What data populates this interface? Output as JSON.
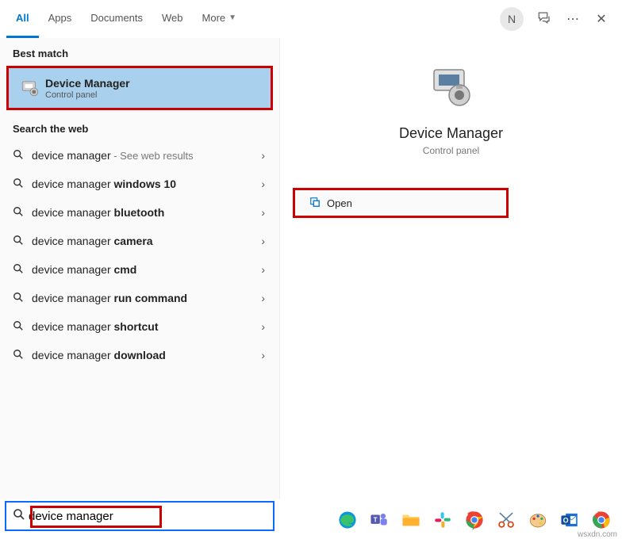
{
  "header": {
    "tabs": [
      "All",
      "Apps",
      "Documents",
      "Web",
      "More"
    ],
    "avatar_initial": "N"
  },
  "left": {
    "best_match_label": "Best match",
    "best_match": {
      "title": "Device Manager",
      "subtitle": "Control panel"
    },
    "web_label": "Search the web",
    "web": [
      {
        "prefix": "device manager",
        "suffix": "",
        "trail": " - See web results"
      },
      {
        "prefix": "device manager ",
        "suffix": "windows 10",
        "trail": ""
      },
      {
        "prefix": "device manager ",
        "suffix": "bluetooth",
        "trail": ""
      },
      {
        "prefix": "device manager ",
        "suffix": "camera",
        "trail": ""
      },
      {
        "prefix": "device manager ",
        "suffix": "cmd",
        "trail": ""
      },
      {
        "prefix": "device manager ",
        "suffix": "run command",
        "trail": ""
      },
      {
        "prefix": "device manager ",
        "suffix": "shortcut",
        "trail": ""
      },
      {
        "prefix": "device manager ",
        "suffix": "download",
        "trail": ""
      }
    ]
  },
  "right": {
    "title": "Device Manager",
    "subtitle": "Control panel",
    "action": "Open"
  },
  "search": {
    "value": "device manager"
  },
  "watermark": "wsxdn.com"
}
